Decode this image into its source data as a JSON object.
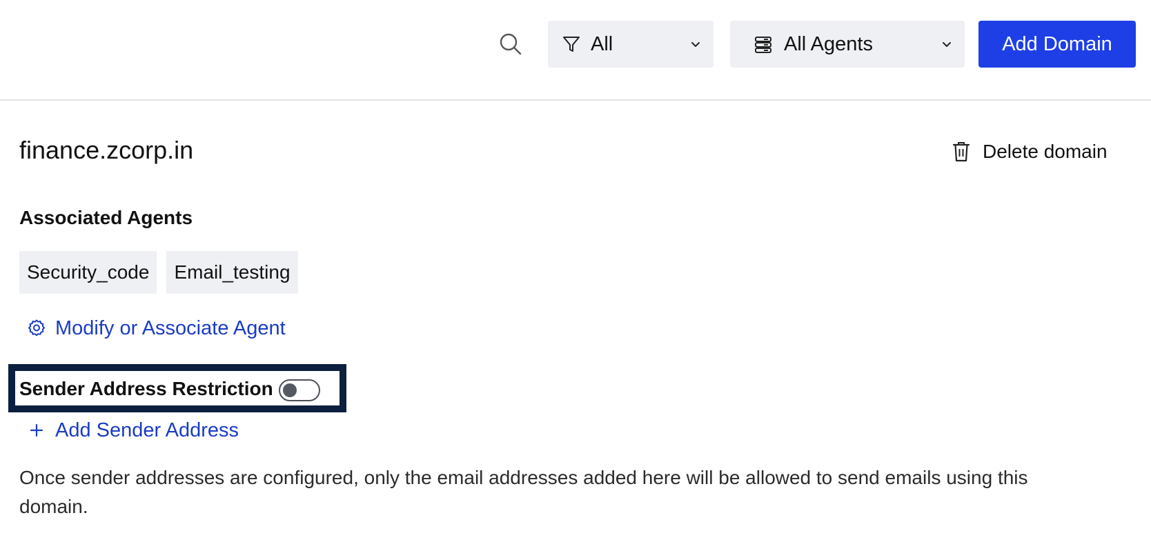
{
  "toolbar": {
    "search_icon": "search-icon",
    "filter": {
      "icon": "filter-icon",
      "selected": "All"
    },
    "agents": {
      "icon": "server-icon",
      "selected": "All Agents"
    },
    "add_domain_label": "Add Domain"
  },
  "domain": {
    "name": "finance.zcorp.in",
    "delete_label": "Delete domain",
    "delete_icon": "trash-icon"
  },
  "associated_agents": {
    "heading": "Associated Agents",
    "agents": [
      "Security_code",
      "Email_testing"
    ],
    "modify_label": "Modify or Associate Agent",
    "modify_icon": "gear-icon"
  },
  "sender_restriction": {
    "label": "Sender Address Restriction",
    "enabled": false,
    "add_label": "Add Sender Address",
    "add_icon": "plus-icon",
    "info": "Once sender addresses are configured, only the email addresses added here will be allowed to send emails using this domain."
  },
  "colors": {
    "primary": "#1e3fe6",
    "link": "#1a3cc4",
    "highlight_border": "#0c1f3f",
    "chip_bg": "#eff0f4"
  }
}
